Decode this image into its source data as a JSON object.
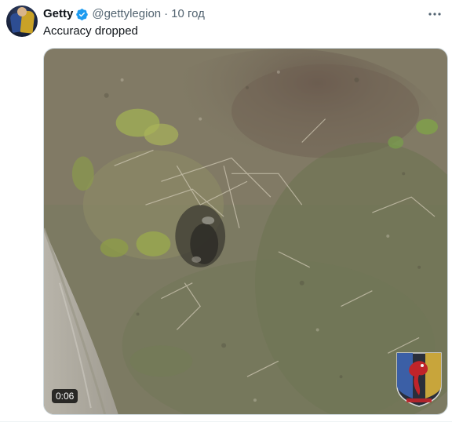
{
  "tweet": {
    "author_name": "Getty",
    "handle": "@gettylegion",
    "separator": "·",
    "timestamp": "10 год",
    "text": "Accuracy dropped",
    "verified_color": "#1d9bf0"
  },
  "media": {
    "type": "video",
    "duration": "0:06"
  },
  "icons": {
    "verified": "verified-badge-icon",
    "more": "more-options-icon",
    "emblem": "unit-emblem"
  }
}
